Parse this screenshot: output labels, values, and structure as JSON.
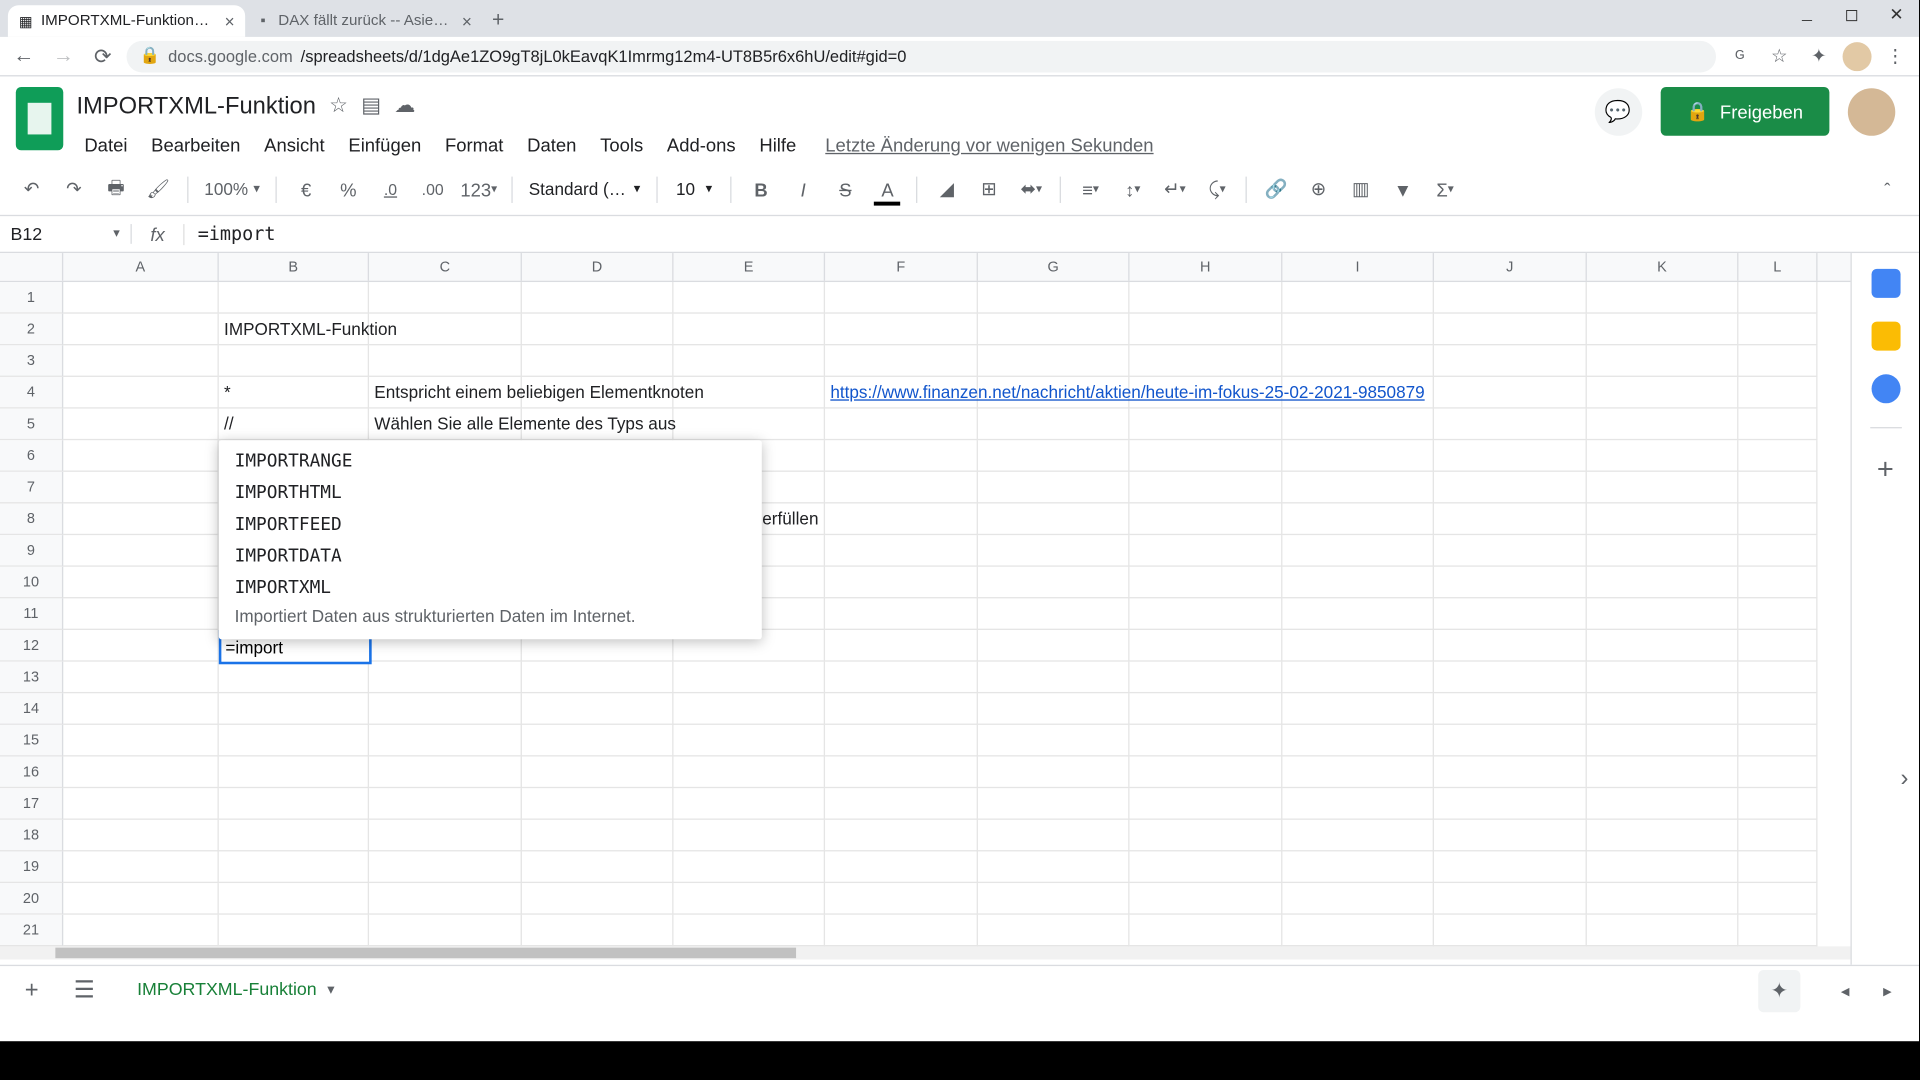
{
  "browser": {
    "tabs": [
      {
        "title": "IMPORTXML-Funktion - Google",
        "favicon": "📗",
        "active": true
      },
      {
        "title": "DAX fällt zurück -- Asiens Börse",
        "favicon": "📈",
        "active": false
      }
    ],
    "url_host": "docs.google.com",
    "url_path": "/spreadsheets/d/1dgAe1ZO9gT8jL0kEavqK1Imrmg12m4-UT8B5r6x6hU/edit#gid=0"
  },
  "doc": {
    "title": "IMPORTXML-Funktion",
    "menus": [
      "Datei",
      "Bearbeiten",
      "Ansicht",
      "Einfügen",
      "Format",
      "Daten",
      "Tools",
      "Add-ons",
      "Hilfe"
    ],
    "last_edit": "Letzte Änderung vor wenigen Sekunden",
    "share_label": "Freigeben"
  },
  "toolbar": {
    "zoom": "100%",
    "currency": "€",
    "percent": "%",
    "dec_less": ".0",
    "dec_more": ".00",
    "num_format": "123",
    "font": "Standard (…",
    "font_size": "10"
  },
  "formula": {
    "name_box": "B12",
    "value": "=import"
  },
  "columns": [
    "A",
    "B",
    "C",
    "D",
    "E",
    "F",
    "G",
    "H",
    "I",
    "J",
    "K",
    "L"
  ],
  "rows": [
    "1",
    "2",
    "3",
    "4",
    "5",
    "6",
    "7",
    "8",
    "9",
    "10",
    "11",
    "12",
    "13",
    "14",
    "15",
    "16",
    "17",
    "18",
    "19",
    "20",
    "21"
  ],
  "cells": {
    "B2": "IMPORTXML-Funktion",
    "B4": "*",
    "C4": "Entspricht einem beliebigen Elementknoten",
    "F4_link": "https://www.finanzen.net/nachricht/aktien/heute-im-fokus-25-02-2021-9850879",
    "B5": "//",
    "C5": "Wählen Sie alle Elemente des Typs aus",
    "C8_tail": "erfüllen",
    "B12_input": "=import"
  },
  "autocomplete": {
    "items": [
      "IMPORTRANGE",
      "IMPORTHTML",
      "IMPORTFEED",
      "IMPORTDATA",
      "IMPORTXML"
    ],
    "desc": "Importiert Daten aus strukturierten Daten im Internet."
  },
  "sheet_tab": "IMPORTXML-Funktion"
}
